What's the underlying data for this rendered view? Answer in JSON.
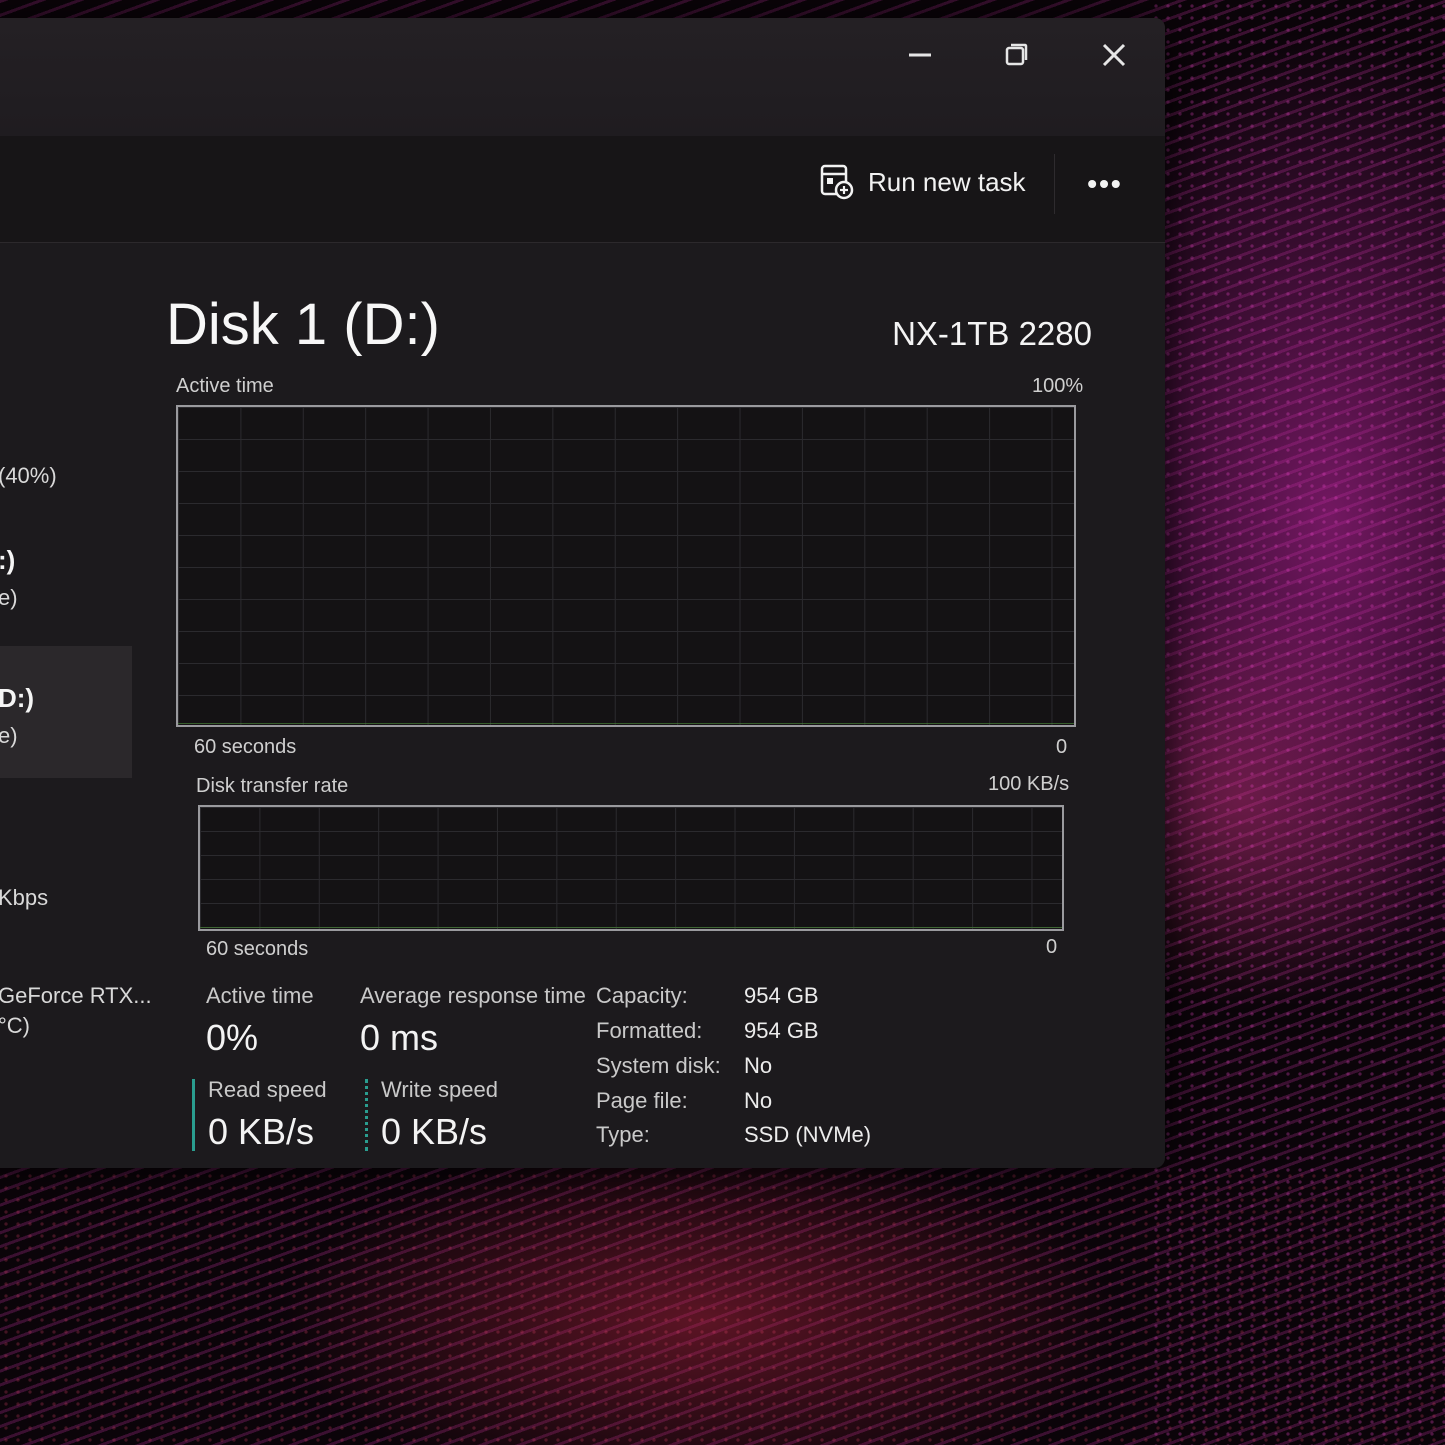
{
  "window": {
    "caption": {
      "minimize": "minimize",
      "maximize": "maximize",
      "close": "close"
    }
  },
  "commandbar": {
    "run_new_task": "Run new task",
    "run_new_task_icon": "run-task-icon",
    "more": "•••"
  },
  "sidebar": {
    "items": [
      {
        "line1": "(40%)"
      },
      {
        "line1": ":)",
        "line2": "e)"
      },
      {
        "line1": "D:)",
        "line2": "e)",
        "selected": true
      },
      {
        "line1": "Kbps"
      },
      {
        "line1": "GeForce RTX...",
        "line2": "°C)"
      }
    ]
  },
  "disk": {
    "title": "Disk 1 (D:)",
    "model": "NX-1TB 2280"
  },
  "active_graph": {
    "label": "Active time",
    "max": "100%",
    "time_span": "60 seconds",
    "min": "0"
  },
  "transfer_graph": {
    "label": "Disk transfer rate",
    "max": "100 KB/s",
    "time_span": "60 seconds",
    "min": "0"
  },
  "stats": {
    "active_time_label": "Active time",
    "active_time_value": "0%",
    "avg_response_label": "Average response time",
    "avg_response_value": "0 ms",
    "read_speed_label": "Read speed",
    "read_speed_value": "0 KB/s",
    "write_speed_label": "Write speed",
    "write_speed_value": "0 KB/s"
  },
  "properties": [
    {
      "label": "Capacity:",
      "value": "954 GB"
    },
    {
      "label": "Formatted:",
      "value": "954 GB"
    },
    {
      "label": "System disk:",
      "value": "No"
    },
    {
      "label": "Page file:",
      "value": "No"
    },
    {
      "label": "Type:",
      "value": "SSD (NVMe)"
    }
  ],
  "colors": {
    "accent_teal": "#2a9d8f",
    "window_bg": "#1c1a1d",
    "wallpaper_magenta": "#e046c8"
  }
}
